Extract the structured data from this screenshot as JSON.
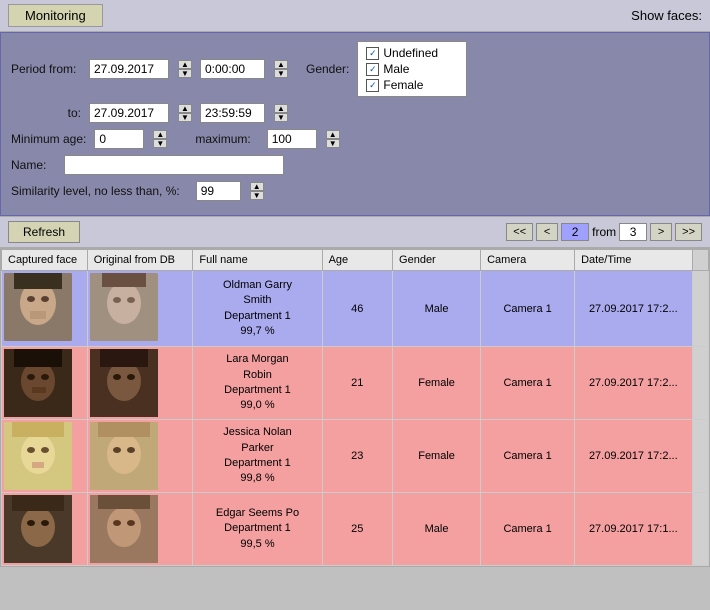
{
  "titleBar": {
    "title": "Monitoring",
    "showFacesLabel": "Show faces:"
  },
  "filters": {
    "periodFromLabel": "Period from:",
    "toLabel": "to:",
    "dateFrom": "27.09.2017",
    "timeFrom": "0:00:00",
    "dateTo": "27.09.2017",
    "timeTo": "23:59:59",
    "genderLabel": "Gender:",
    "genderOptions": [
      {
        "label": "Undefined",
        "checked": true
      },
      {
        "label": "Male",
        "checked": true
      },
      {
        "label": "Female",
        "checked": true
      }
    ],
    "minAgeLabel": "Minimum age:",
    "minAge": "0",
    "maxAgeLabel": "maximum:",
    "maxAge": "100",
    "nameLabel": "Name:",
    "namePlaceholder": "",
    "similarityLabel": "Similarity level, no less than, %:",
    "similarity": "99"
  },
  "actionBar": {
    "refreshLabel": "Refresh",
    "pagination": {
      "prevPrevLabel": "<<",
      "prevLabel": "<",
      "currentPage": "2",
      "fromLabel": "from",
      "totalPages": "3",
      "nextLabel": ">",
      "nextNextLabel": ">>"
    }
  },
  "table": {
    "columns": [
      "Captured face",
      "Original from DB",
      "Full name",
      "Age",
      "Gender",
      "Camera",
      "Date/Time"
    ],
    "rows": [
      {
        "rowType": "blue",
        "fullName": "Oldman Garry Smith\nDepartment 1\n99,7 %",
        "fullNameDisplay": "Oldman Garry\nSmith\nDepartment 1\n99,7 %",
        "age": "46",
        "gender": "Male",
        "camera": "Camera 1",
        "datetime": "27.09.2017 17:2..."
      },
      {
        "rowType": "pink",
        "fullName": "Lara Morgan Robin\nDepartment 1\n99,0 %",
        "fullNameDisplay": "Lara Morgan\nRobin\nDepartment 1\n99,0 %",
        "age": "21",
        "gender": "Female",
        "camera": "Camera 1",
        "datetime": "27.09.2017 17:2..."
      },
      {
        "rowType": "pink",
        "fullName": "Jessica Nolan Parker\nDepartment 1\n99,8 %",
        "fullNameDisplay": "Jessica Nolan\nParker\nDepartment 1\n99,8 %",
        "age": "23",
        "gender": "Female",
        "camera": "Camera 1",
        "datetime": "27.09.2017 17:2..."
      },
      {
        "rowType": "pink",
        "fullName": "Edgar Seems Po\nDepartment 1\n99,5 %",
        "fullNameDisplay": "Edgar Seems Po\nDepartment 1\n99,5 %",
        "age": "25",
        "gender": "Male",
        "camera": "Camera 1",
        "datetime": "27.09.2017 17:1..."
      }
    ]
  },
  "colors": {
    "rowBlue": "#aaaaee",
    "rowPink": "#f4a0a0",
    "headerBg": "#8888aa",
    "titleBg": "#c8c8d8"
  }
}
